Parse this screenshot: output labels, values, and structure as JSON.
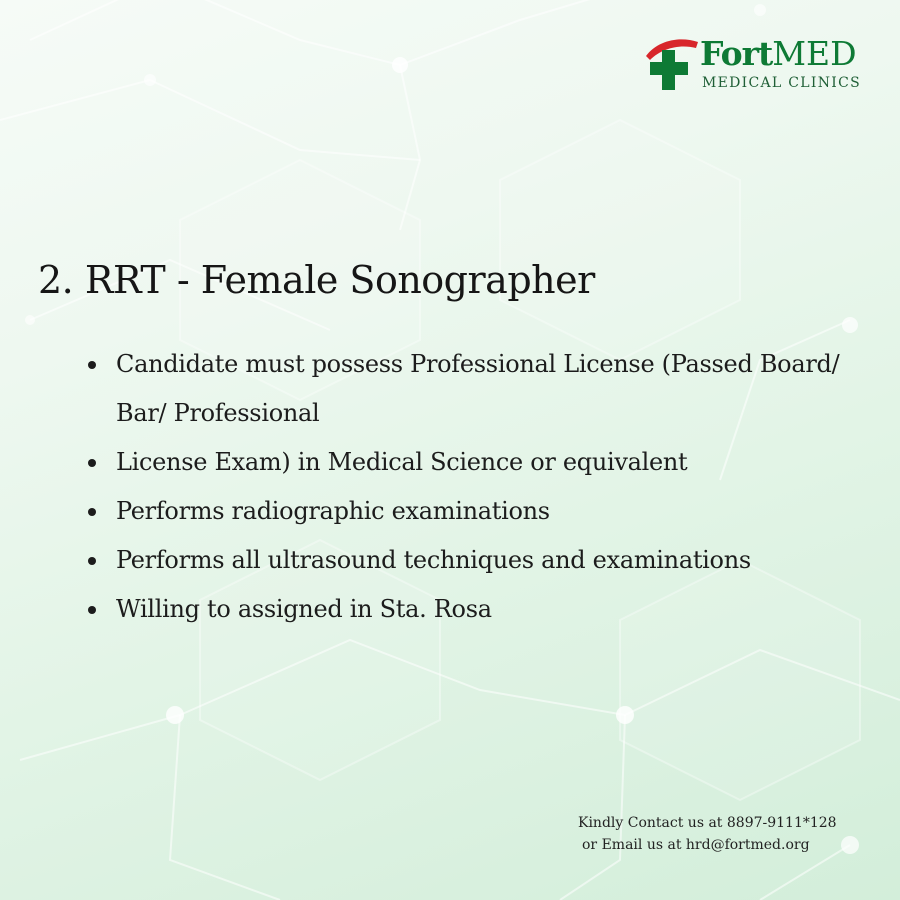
{
  "brand": {
    "name_part1": "Fort",
    "name_part2": "MED",
    "subtitle": "MEDICAL CLINICS",
    "colors": {
      "green": "#0e7a35",
      "red": "#d8262b"
    }
  },
  "job": {
    "title": "2. RRT - Female Sonographer",
    "requirements": [
      "Candidate must possess Professional License (Passed Board/ Bar/ Professional",
      "License Exam) in Medical Science or equivalent",
      "Performs radiographic examinations",
      "Performs all ultrasound techniques and examinations",
      "Willing to assigned in Sta. Rosa"
    ]
  },
  "contact": {
    "line1": "Kindly Contact us at 8897-9111*128",
    "line2": "or Email us at hrd@fortmed.org"
  }
}
